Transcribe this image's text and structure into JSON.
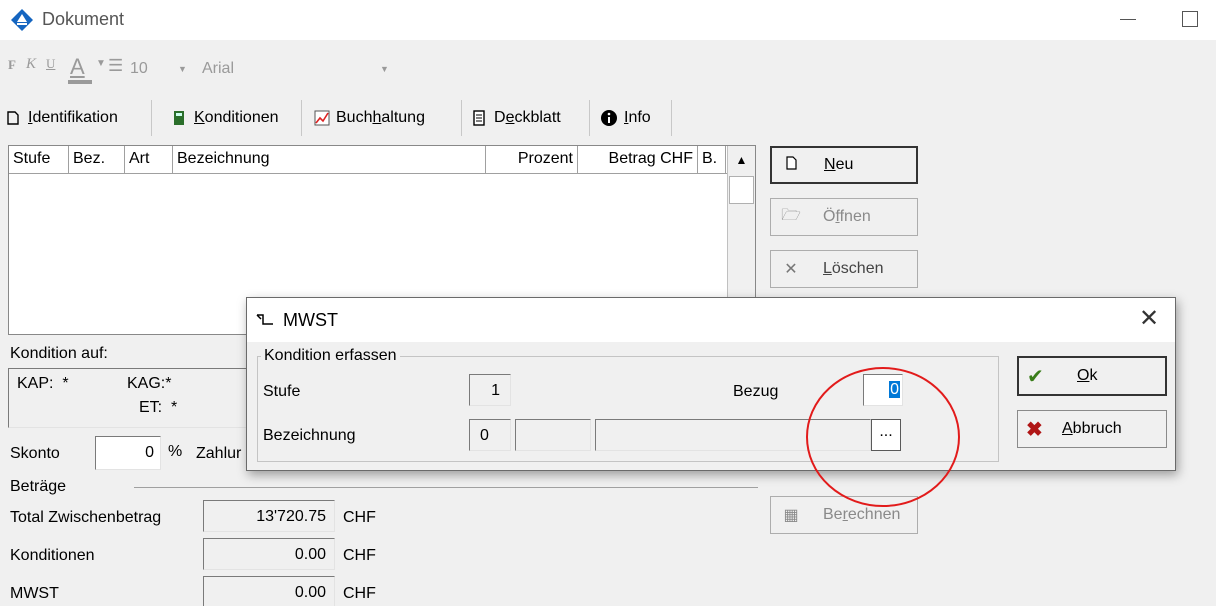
{
  "window": {
    "title": "Dokument"
  },
  "toolbar": {
    "bold": "F",
    "italic": "K",
    "underline": "U",
    "font_color": "A",
    "font_size": "10",
    "font_name": "Arial"
  },
  "tabs": [
    {
      "label_pre": "",
      "label_u": "I",
      "label_post": "dentifikation"
    },
    {
      "label_pre": "",
      "label_u": "K",
      "label_post": "onditionen"
    },
    {
      "label_pre": "Buch",
      "label_u": "h",
      "label_post": "altung"
    },
    {
      "label_pre": "D",
      "label_u": "e",
      "label_post": "ckblatt"
    },
    {
      "label_pre": "",
      "label_u": "I",
      "label_post": "nfo"
    }
  ],
  "list": {
    "columns": [
      "Stufe",
      "Bez.",
      "Art",
      "Bezeichnung",
      "Prozent",
      "Betrag CHF",
      "B."
    ]
  },
  "side_buttons": {
    "neu_u": "N",
    "neu_rest": "eu",
    "oeffnen_pre": "Ö",
    "oeffnen_u": "f",
    "oeffnen_post": "fnen",
    "loeschen_u": "L",
    "loeschen_rest": "öschen",
    "berechnen_pre": "Be",
    "berechnen_u": "r",
    "berechnen_post": "echnen"
  },
  "kondition": {
    "label": "Kondition auf:",
    "kap": "KAP:  *",
    "kag": "KAG:*",
    "et": "ET:  *"
  },
  "skonto": {
    "label": "Skonto",
    "value": "0",
    "percent": "%",
    "zahlung_partial": "Zahlur"
  },
  "betraege": {
    "label": "Beträge",
    "rows": [
      {
        "label": "Total Zwischenbetrag",
        "value": "13'720.75",
        "unit": "CHF"
      },
      {
        "label": "Konditionen",
        "value": "0.00",
        "unit": "CHF"
      },
      {
        "label": "MWST",
        "value": "0.00",
        "unit": "CHF"
      }
    ]
  },
  "dialog": {
    "title": "MWST",
    "group_label": "Kondition erfassen",
    "stufe_label": "Stufe",
    "stufe_value": "1",
    "bezug_label": "Bezug",
    "bezug_value": "0",
    "bezeichnung_label": "Bezeichnung",
    "bezeichnung_value": "0",
    "ellipsis": "...",
    "ok_u": "O",
    "ok_rest": "k",
    "abbruch_u": "A",
    "abbruch_rest": "bbruch"
  },
  "colors": {
    "annotation_circle": "#e21b1b",
    "selection": "#0078d7",
    "ok_check": "#3a7d1a",
    "abbruch_x": "#b01515"
  }
}
